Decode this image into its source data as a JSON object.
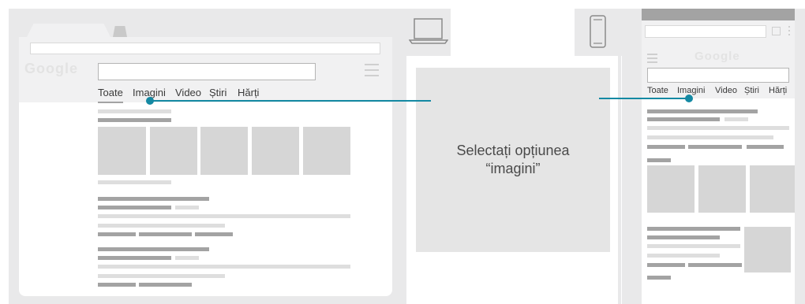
{
  "desktop": {
    "logo": "Google",
    "tabs": [
      "Toate",
      "Imagini",
      "Video",
      "Știri",
      "Hărți"
    ]
  },
  "instruction": {
    "line1": "Selectați opțiunea",
    "line2": "“imagini”"
  },
  "mobile": {
    "logo": "Google",
    "tabs": [
      "Toate",
      "Imagini",
      "Video",
      "Știri",
      "Hărți"
    ]
  },
  "colors": {
    "accent": "#1489a3",
    "frame": "#e9e9ea",
    "placeholder_dark": "#a3a3a3",
    "placeholder_light": "#dedede",
    "image_placeholder": "#d6d6d6"
  },
  "icons": {
    "desktop": "laptop-icon",
    "mobile": "smartphone-icon"
  }
}
